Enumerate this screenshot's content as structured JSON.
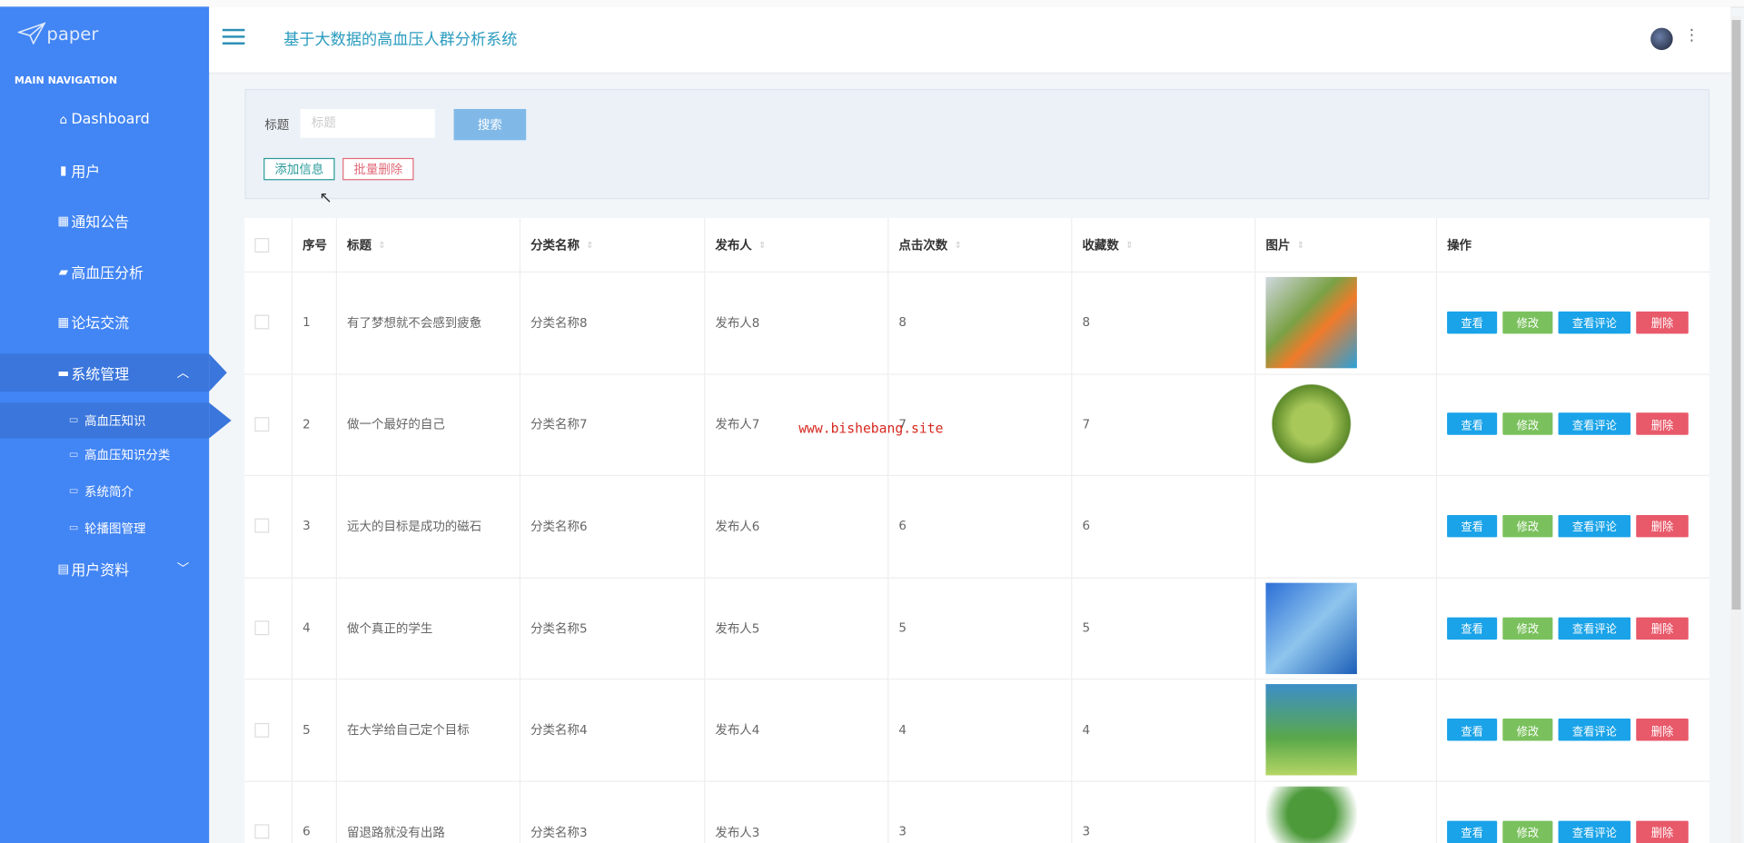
{
  "app": {
    "logo": "paper",
    "title": "基于大数据的高血压人群分析系统"
  },
  "sidebar": {
    "section": "MAIN NAVIGATION",
    "items": [
      {
        "label": "Dashboard",
        "icon": "home-icon"
      },
      {
        "label": "用户",
        "icon": "clipboard-icon"
      },
      {
        "label": "通知公告",
        "icon": "grid-icon"
      },
      {
        "label": "高血压分析",
        "icon": "briefcase-icon"
      },
      {
        "label": "论坛交流",
        "icon": "grid-icon"
      },
      {
        "label": "系统管理",
        "icon": "lock-icon"
      },
      {
        "label": "用户资料",
        "icon": "card-icon"
      }
    ],
    "sub_items": [
      {
        "label": "高血压知识"
      },
      {
        "label": "高血压知识分类"
      },
      {
        "label": "系统简介"
      },
      {
        "label": "轮播图管理"
      }
    ]
  },
  "search": {
    "label": "标题",
    "placeholder": "标题",
    "value": "",
    "button": "搜索"
  },
  "actions": {
    "add": "添加信息",
    "batch_delete": "批量删除"
  },
  "table": {
    "columns": [
      "序号",
      "标题",
      "分类名称",
      "发布人",
      "点击次数",
      "收藏数",
      "图片",
      "操作"
    ],
    "row_actions": [
      "查看",
      "修改",
      "查看评论",
      "删除"
    ],
    "rows": [
      {
        "no": "1",
        "title": "有了梦想就不会感到疲惫",
        "category": "分类名称8",
        "author": "发布人8",
        "clicks": "8",
        "favorites": "8"
      },
      {
        "no": "2",
        "title": "做一个最好的自己",
        "category": "分类名称7",
        "author": "发布人7",
        "clicks": "7",
        "favorites": "7"
      },
      {
        "no": "3",
        "title": "远大的目标是成功的磁石",
        "category": "分类名称6",
        "author": "发布人6",
        "clicks": "6",
        "favorites": "6"
      },
      {
        "no": "4",
        "title": "做个真正的学生",
        "category": "分类名称5",
        "author": "发布人5",
        "clicks": "5",
        "favorites": "5"
      },
      {
        "no": "5",
        "title": "在大学给自己定个目标",
        "category": "分类名称4",
        "author": "发布人4",
        "clicks": "4",
        "favorites": "4"
      },
      {
        "no": "6",
        "title": "留退路就没有出路",
        "category": "分类名称3",
        "author": "发布人3",
        "clicks": "3",
        "favorites": "3"
      }
    ]
  },
  "watermark": "www.bishebang.site",
  "colors": {
    "sidebar": "#4285f4",
    "view": "#1aa3e8",
    "edit": "#7ac15d",
    "comments": "#1aa3e8",
    "delete": "#e8596a"
  }
}
